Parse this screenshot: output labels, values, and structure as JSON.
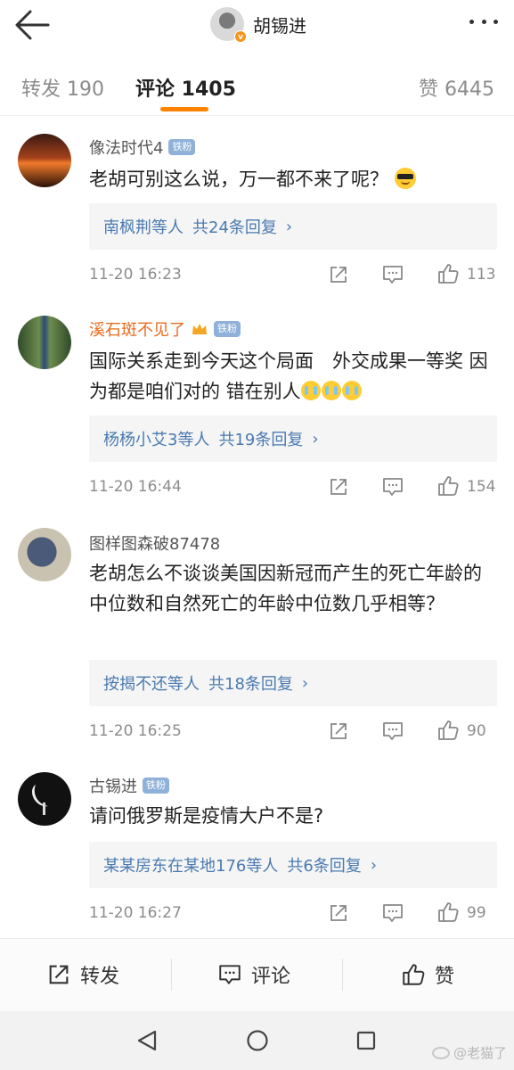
{
  "header": {
    "back_icon": "arrow-left-icon",
    "title": "胡锡进",
    "verified_badge": "v",
    "more_icon": "more-dots-icon"
  },
  "tabs": {
    "repost": "转发 190",
    "comment": "评论 1405",
    "like": "赞 6445",
    "accent_color": "#ff8200"
  },
  "comments": [
    {
      "name": "像法时代4",
      "badge": "铁粉",
      "text": "老胡可别这么说，万一都不来了呢？",
      "emoji": "sunglasses-emoji",
      "reply_users": "南枫荆等人",
      "reply_count": "共24条回复",
      "time": "11-20 16:23",
      "likes": "113"
    },
    {
      "name": "溪石斑不见了",
      "badge": "铁粉",
      "text": "国际关系走到今天这个局面　外交成果一等奖  因为都是咱们对的  错在别人",
      "emoji": "crying-emoji",
      "reply_users": "杨杨小艾3等人",
      "reply_count": "共19条回复",
      "time": "11-20 16:44",
      "likes": "154"
    },
    {
      "name": "图样图森破87478",
      "badge": "",
      "text": "老胡怎么不谈谈美国因新冠而产生的死亡年龄的中位数和自然死亡的年龄中位数几乎相等？",
      "reply_users": "按揭不还等人",
      "reply_count": "共18条回复",
      "time": "11-20 16:25",
      "likes": "90"
    },
    {
      "name": "古锡进",
      "badge": "铁粉",
      "text": "请问俄罗斯是疫情大户不是?",
      "reply_users": "某某房东在某地176等人",
      "reply_count": "共6条回复",
      "time": "11-20 16:27",
      "likes": "99"
    }
  ],
  "actionbar": {
    "repost": "转发",
    "comment": "评论",
    "like": "赞"
  },
  "watermark": "@老猫了"
}
